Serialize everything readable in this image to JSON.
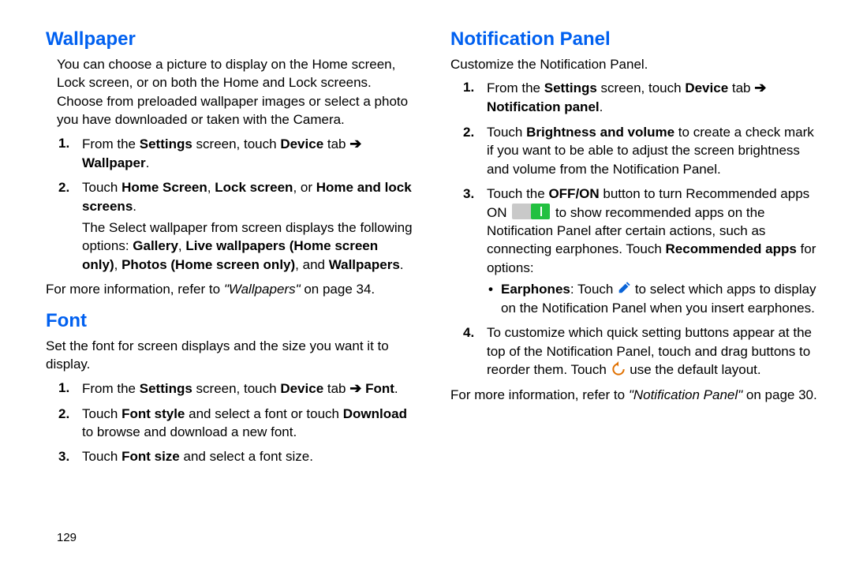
{
  "page_number": "129",
  "left": {
    "wallpaper": {
      "heading": "Wallpaper",
      "intro": "You can choose a picture to display on the Home screen, Lock screen, or on both the Home and Lock screens. Choose from preloaded wallpaper images or select a photo you have downloaded or taken with the Camera.",
      "steps": [
        {
          "num": "1.",
          "parts": [
            "From the ",
            "Settings",
            " screen, touch ",
            "Device",
            " tab ",
            "➔",
            " ",
            "Wallpaper",
            "."
          ]
        },
        {
          "num": "2.",
          "parts": [
            "Touch ",
            "Home Screen",
            ", ",
            "Lock screen",
            ", or ",
            "Home and lock screens",
            "."
          ],
          "extra_parts": [
            "The Select wallpaper from screen displays the following options: ",
            "Gallery",
            ", ",
            "Live wallpapers (Home screen only)",
            ", ",
            "Photos (Home screen only)",
            ", and ",
            "Wallpapers",
            "."
          ]
        }
      ],
      "more_info_parts": [
        "For more information, refer to ",
        "\"Wallpapers\"",
        " on page 34."
      ]
    },
    "font": {
      "heading": "Font",
      "intro": "Set the font for screen displays and the size you want it to display.",
      "steps": [
        {
          "num": "1.",
          "parts": [
            "From the ",
            "Settings",
            " screen, touch ",
            "Device",
            " tab ",
            "➔",
            " ",
            "Font",
            "."
          ]
        },
        {
          "num": "2.",
          "parts": [
            "Touch ",
            "Font style",
            " and select a font or touch ",
            "Download",
            " to browse and download a new font."
          ]
        },
        {
          "num": "3.",
          "parts": [
            "Touch ",
            "Font size",
            " and select a font size."
          ]
        }
      ]
    }
  },
  "right": {
    "notif": {
      "heading": "Notification Panel",
      "intro": "Customize the Notification Panel.",
      "steps": {
        "s1": {
          "num": "1.",
          "pre": "From the ",
          "b1": "Settings",
          "mid1": " screen, touch ",
          "b2": "Device",
          "mid2": " tab ",
          "arrow": "➔",
          "sp": " ",
          "b3": "Notification panel",
          "end": "."
        },
        "s2": {
          "num": "2.",
          "pre": "Touch ",
          "b1": "Brightness and volume",
          "rest": " to create a check mark if you want to be able to adjust the screen brightness and volume from the Notification Panel."
        },
        "s3": {
          "num": "3.",
          "pre": "Touch the ",
          "b1": "OFF/ON",
          "mid1": " button to turn Recommended apps ON ",
          "mid2": " to show recommended apps on the Notification Panel after certain actions, such as connecting earphones. Touch ",
          "b2": "Recommended apps",
          "end": " for options:"
        },
        "s3_bullet": {
          "b1": "Earphones",
          "mid1": ": Touch ",
          "rest": " to select which apps to display on the Notification Panel when you insert earphones."
        },
        "s4": {
          "num": "4.",
          "pre": "To customize which quick setting buttons appear at the top of the Notification Panel, touch and drag buttons to reorder them. Touch ",
          "rest": " use the default layout."
        }
      },
      "more_info_parts": [
        "For more information, refer to ",
        "\"Notification Panel\"",
        " on page 30."
      ]
    }
  }
}
